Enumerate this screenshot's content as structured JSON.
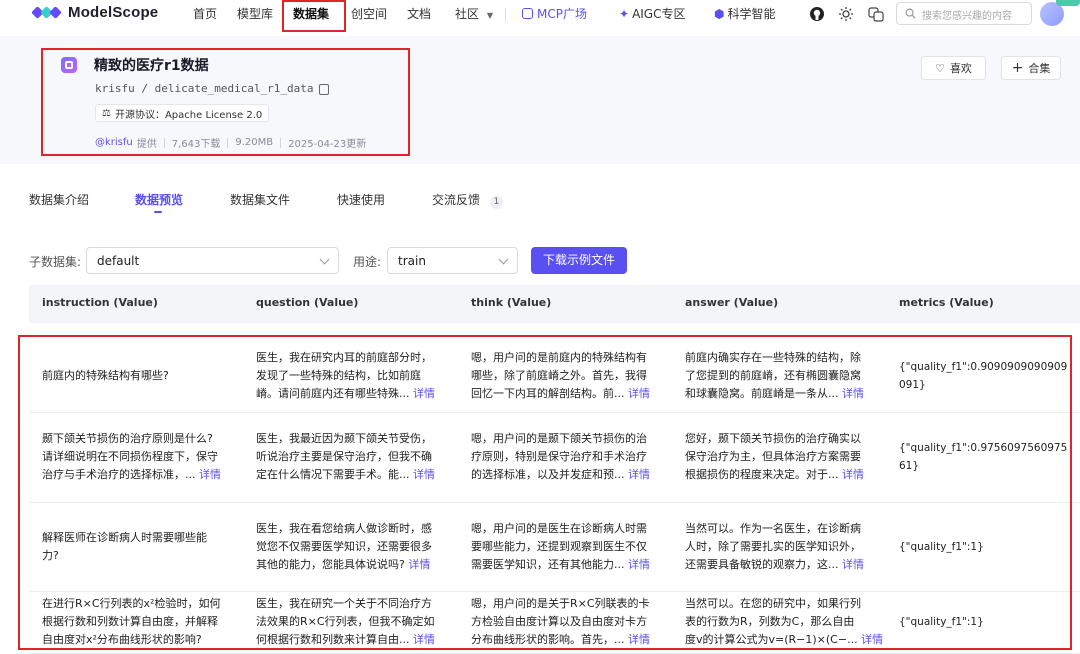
{
  "nav": {
    "logo": "ModelScope",
    "items": [
      "首页",
      "模型库",
      "数据集",
      "创空间",
      "文档",
      "社区"
    ],
    "extras": [
      "MCP广场",
      "AIGC专区",
      "科学智能"
    ],
    "search_placeholder": "搜索您感兴趣的内容"
  },
  "dataset": {
    "title": "精致的医疗r1数据",
    "path": "krisfu / delicate_medical_r1_data",
    "license": "开源协议：Apache License 2.0",
    "author": "@krisfu",
    "provide": "提供",
    "downloads": "7,643下载",
    "size": "9.20MB",
    "updated": "2025-04-23更新",
    "like_label": "喜欢",
    "collect_label": "合集"
  },
  "tabs": {
    "intro": "数据集介绍",
    "preview": "数据预览",
    "files": "数据集文件",
    "quickstart": "快速使用",
    "feedback": "交流反馈",
    "feedback_count": "1"
  },
  "filters": {
    "subset_label": "子数据集:",
    "subset_value": "default",
    "split_label": "用途:",
    "split_value": "train",
    "download_label": "下载示例文件"
  },
  "table": {
    "columns": [
      "instruction (Value)",
      "question (Value)",
      "think (Value)",
      "answer (Value)",
      "metrics (Value)"
    ],
    "more": "详情",
    "rows": [
      {
        "instruction": [
          "前庭内的特殊结构有哪些?"
        ],
        "question": [
          "医生，我在研究内耳的前庭部分时，",
          "发现了一些特殊的结构，比如前庭",
          "嵴。请问前庭内还有哪些特殊..."
        ],
        "think": [
          "嗯，用户问的是前庭内的特殊结构有",
          "哪些，除了前庭嵴之外。首先，我得",
          "回忆一下内耳的解剖结构。前..."
        ],
        "answer": [
          "前庭内确实存在一些特殊的结构，除",
          "了您提到的前庭嵴，还有椭圆囊隐窝",
          "和球囊隐窝。前庭嵴是一条从..."
        ],
        "metrics": [
          "{\"quality_f1\":0.9090909090909",
          "091}"
        ]
      },
      {
        "instruction": [
          "颞下颌关节损伤的治疗原则是什么?",
          "请详细说明在不同损伤程度下，保守",
          "治疗与手术治疗的选择标准，..."
        ],
        "question": [
          "医生，我最近因为颞下颌关节受伤，",
          "听说治疗主要是保守治疗，但我不确",
          "定在什么情况下需要手术。能..."
        ],
        "think": [
          "嗯，用户问的是颞下颌关节损伤的治",
          "疗原则，特别是保守治疗和手术治疗",
          "的选择标准，以及并发症和预..."
        ],
        "answer": [
          "您好，颞下颌关节损伤的治疗确实以",
          "保守治疗为主，但具体治疗方案需要",
          "根据损伤的程度来决定。对于..."
        ],
        "metrics": [
          "{\"quality_f1\":0.9756097560975",
          "61}"
        ]
      },
      {
        "instruction": [
          "解释医师在诊断病人时需要哪些能",
          "力?"
        ],
        "question": [
          "医生，我在看您给病人做诊断时，感",
          "觉您不仅需要医学知识，还需要很多",
          "其他的能力，您能具体说说吗?"
        ],
        "think": [
          "嗯，用户问的是医生在诊断病人时需",
          "要哪些能力，还提到观察到医生不仅",
          "需要医学知识，还有其他能力..."
        ],
        "answer": [
          "当然可以。作为一名医生，在诊断病",
          "人时，除了需要扎实的医学知识外，",
          "还需要具备敏锐的观察力，这..."
        ],
        "metrics": [
          "{\"quality_f1\":1}"
        ]
      },
      {
        "instruction": [
          "在进行R×C行列表的x²检验时，如何",
          "根据行数和列数计算自由度，并解释",
          "自由度对x²分布曲线形状的影响?"
        ],
        "question": [
          "医生，我在研究一个关于不同治疗方",
          "法效果的R×C行列表，但我不确定如",
          "何根据行数和列数来计算自由..."
        ],
        "think": [
          "嗯，用户问的是关于R×C列联表的卡",
          "方检验自由度计算以及自由度对卡方",
          "分布曲线形状的影响。首先，..."
        ],
        "answer": [
          "当然可以。在您的研究中，如果行列",
          "表的行数为R，列数为C，那么自由",
          "度v的计算公式为v=(R−1)×(C−..."
        ],
        "metrics": [
          "{\"quality_f1\":1}"
        ]
      }
    ]
  },
  "colors": {
    "accent": "#5a4ff0",
    "highlight": "#e0242b"
  }
}
